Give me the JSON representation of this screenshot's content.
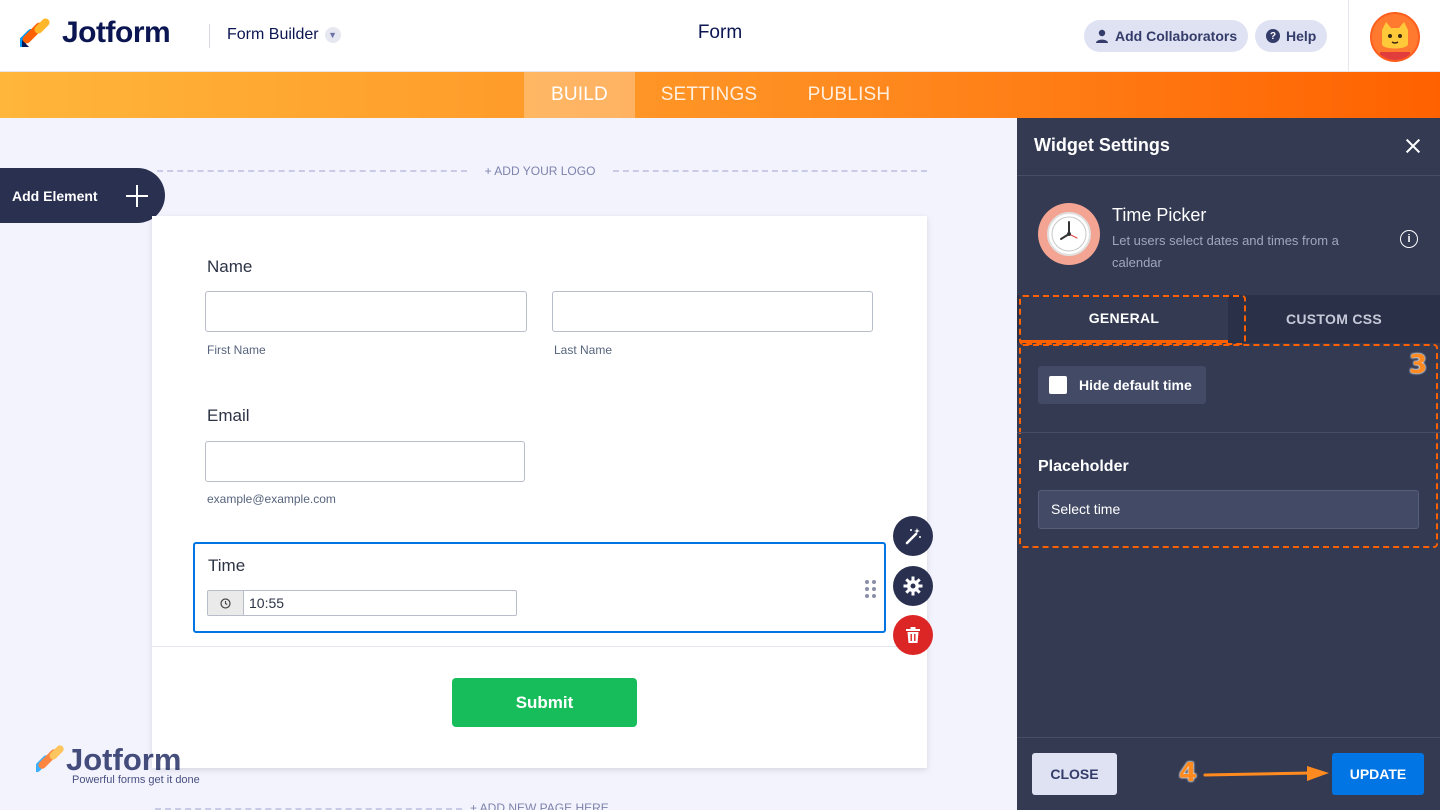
{
  "header": {
    "brand": "Jotform",
    "builder_label": "Form Builder",
    "form_title": "Form",
    "add_collaborators": "Add Collaborators",
    "help": "Help"
  },
  "nav": {
    "tabs": [
      {
        "label": "BUILD",
        "active": true
      },
      {
        "label": "SETTINGS",
        "active": false
      },
      {
        "label": "PUBLISH",
        "active": false
      }
    ]
  },
  "canvas": {
    "add_logo": "+ ADD YOUR LOGO",
    "add_element": "Add Element",
    "add_page": "+ ADD NEW PAGE HERE",
    "watermark_brand": "Jotform",
    "watermark_slogan": "Powerful forms get it done"
  },
  "form": {
    "name_label": "Name",
    "first_name_sub": "First Name",
    "last_name_sub": "Last Name",
    "email_label": "Email",
    "email_sub": "example@example.com",
    "time_label": "Time",
    "time_value": "10:55",
    "submit_label": "Submit"
  },
  "widget_panel": {
    "title": "Widget Settings",
    "widget_name": "Time Picker",
    "widget_desc": "Let users select dates and times from a calendar",
    "tabs": [
      {
        "label": "GENERAL",
        "active": true
      },
      {
        "label": "CUSTOM CSS",
        "active": false
      }
    ],
    "hide_default_time_label": "Hide default time",
    "hide_default_time_checked": false,
    "placeholder_label": "Placeholder",
    "placeholder_value": "Select time",
    "close_label": "CLOSE",
    "update_label": "UPDATE"
  },
  "annotations": {
    "step3": "3",
    "step4": "4"
  },
  "colors": {
    "accent_orange": "#ff6100",
    "brand_navy": "#0a1551",
    "primary_blue": "#0075e3",
    "submit_green": "#18bd5b",
    "delete_red": "#dc2626"
  }
}
